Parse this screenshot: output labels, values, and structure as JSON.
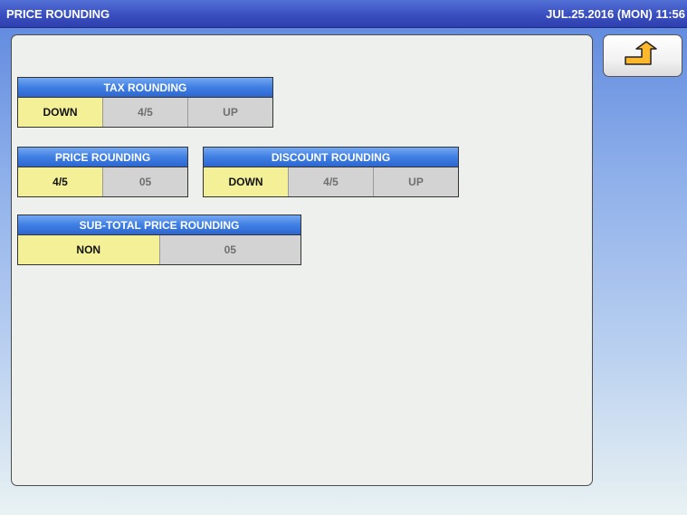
{
  "header": {
    "title": "PRICE ROUNDING",
    "datetime": "JUL.25.2016 (MON)  11:56"
  },
  "back_button": {
    "icon": "return-arrow-icon",
    "icon_color": "#f0a020"
  },
  "colors": {
    "selected": "#f4f098",
    "unselected": "#d3d3d3",
    "header_blue": "#3f7fe3",
    "title_bar": "#3a4fbf"
  },
  "groups": {
    "tax": {
      "label": "TAX ROUNDING",
      "options": [
        "DOWN",
        "4/5",
        "UP"
      ],
      "selected": "DOWN"
    },
    "price": {
      "label": "PRICE ROUNDING",
      "options": [
        "4/5",
        "05"
      ],
      "selected": "4/5"
    },
    "discount": {
      "label": "DISCOUNT ROUNDING",
      "options": [
        "DOWN",
        "4/5",
        "UP"
      ],
      "selected": "DOWN"
    },
    "subtotal": {
      "label": "SUB-TOTAL PRICE ROUNDING",
      "options": [
        "NON",
        "05"
      ],
      "selected": "NON"
    }
  }
}
